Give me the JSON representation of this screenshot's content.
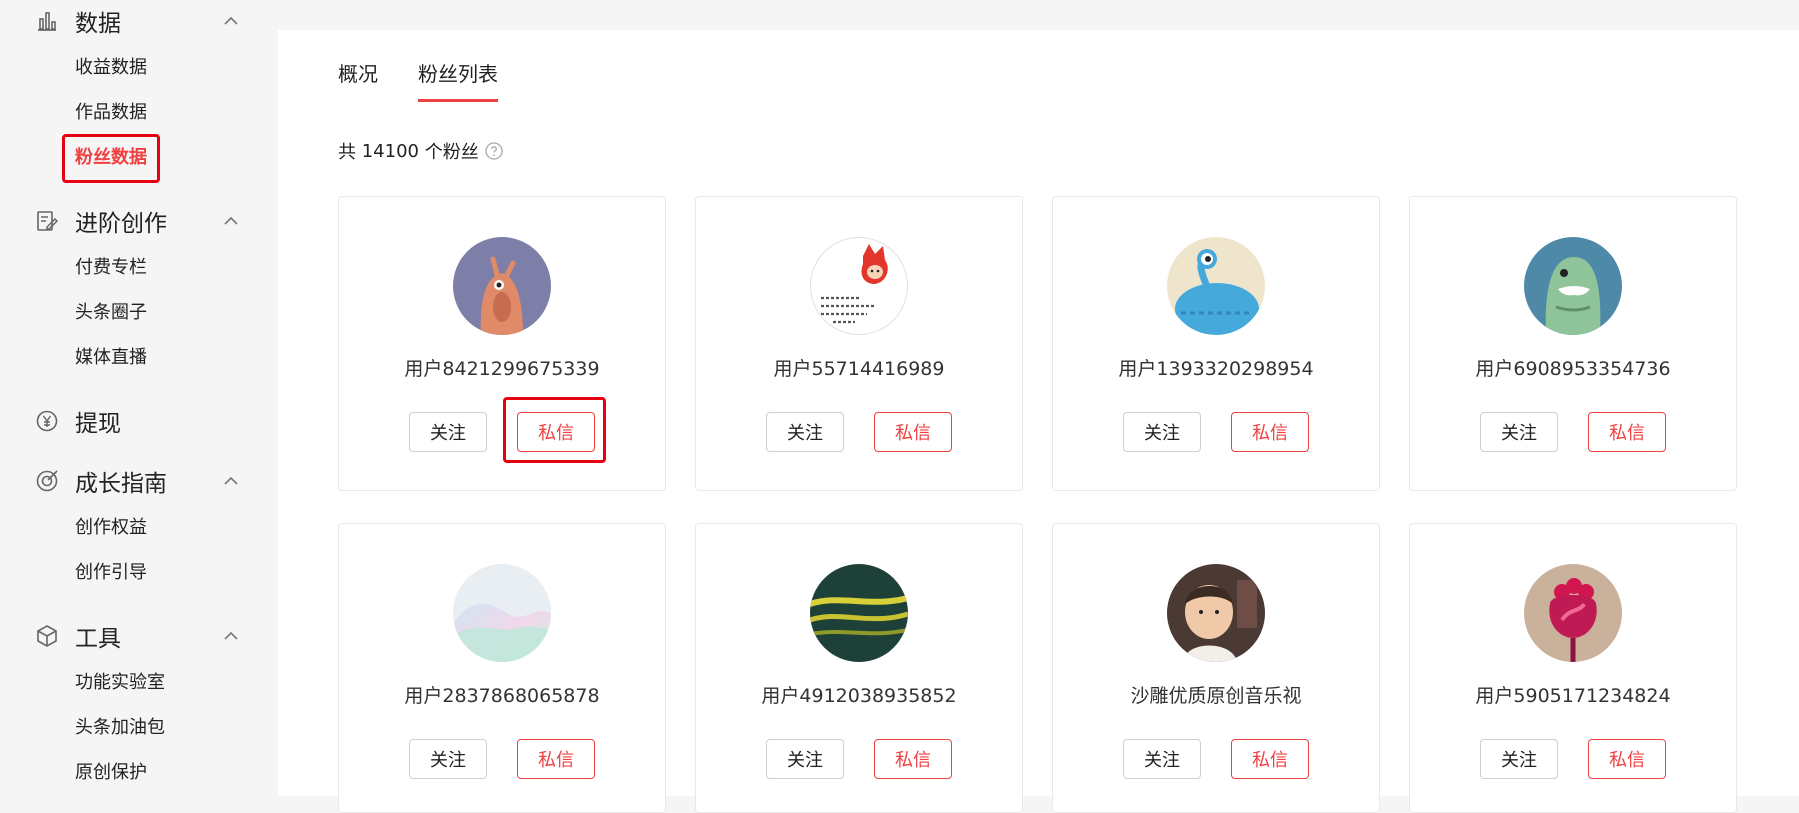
{
  "sidebar": {
    "sections": [
      {
        "title": "数据",
        "icon": "bar-chart-icon",
        "expanded": true
      },
      {
        "title": "进阶创作",
        "icon": "edit-doc-icon",
        "expanded": true
      },
      {
        "title": "提现",
        "icon": "yen-coin-icon"
      },
      {
        "title": "成长指南",
        "icon": "growth-target-icon",
        "expanded": true
      },
      {
        "title": "工具",
        "icon": "cube-icon",
        "expanded": true
      }
    ],
    "data_items": [
      "收益数据",
      "作品数据",
      "粉丝数据"
    ],
    "advanced_items": [
      "付费专栏",
      "头条圈子",
      "媒体直播"
    ],
    "growth_items": [
      "创作权益",
      "创作引导"
    ],
    "tool_items": [
      "功能实验室",
      "头条加油包",
      "原创保护"
    ],
    "active_item": "粉丝数据"
  },
  "tabs": [
    {
      "label": "概况",
      "active": false
    },
    {
      "label": "粉丝列表",
      "active": true
    }
  ],
  "summary": {
    "prefix": "共",
    "count": "14100",
    "suffix": "个粉丝"
  },
  "buttons": {
    "follow": "关注",
    "message": "私信"
  },
  "fans": [
    {
      "name": "用户8421299675339",
      "avatar": "brown-creature-avatar"
    },
    {
      "name": "用户55714416989",
      "avatar": "red-fox-cartoon-avatar"
    },
    {
      "name": "用户1393320298954",
      "avatar": "blue-alien-avatar"
    },
    {
      "name": "用户6908953354736",
      "avatar": "green-monster-avatar"
    },
    {
      "name": "用户2837868065878",
      "avatar": "iridescent-waves-avatar"
    },
    {
      "name": "用户4912038935852",
      "avatar": "yellow-lines-avatar"
    },
    {
      "name": "沙雕优质原创音乐视",
      "avatar": "child-photo-avatar"
    },
    {
      "name": "用户5905171234824",
      "avatar": "pink-flower-avatar"
    }
  ],
  "colors": {
    "accent": "#f04142",
    "highlight": "#e60012",
    "sidebar_bg": "#f5f5f5"
  }
}
